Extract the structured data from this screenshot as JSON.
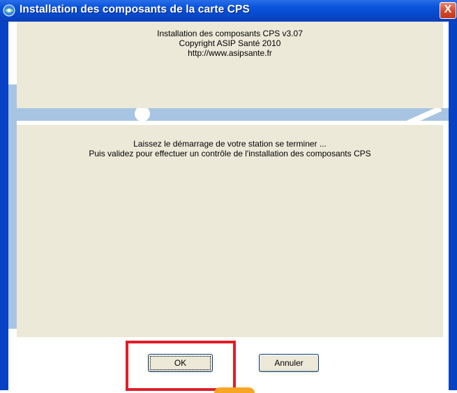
{
  "window": {
    "title": "Installation des composants de la carte CPS",
    "close_label": "X"
  },
  "info": {
    "line1": "Installation des composants CPS v3.07",
    "line2": "Copyright ASIP Santé 2010",
    "line3": "http://www.asipsante.fr"
  },
  "message": {
    "line1": "Laissez le démarrage de votre station se terminer ...",
    "line2": "Puis validez pour effectuer un contrôle de l'installation des composants CPS"
  },
  "buttons": {
    "ok": "OK",
    "cancel": "Annuler"
  },
  "colors": {
    "titlebar": "#0b56de",
    "panel": "#ece9d8",
    "accent_band": "#a7c4e2",
    "highlight_box": "#e21d27"
  }
}
